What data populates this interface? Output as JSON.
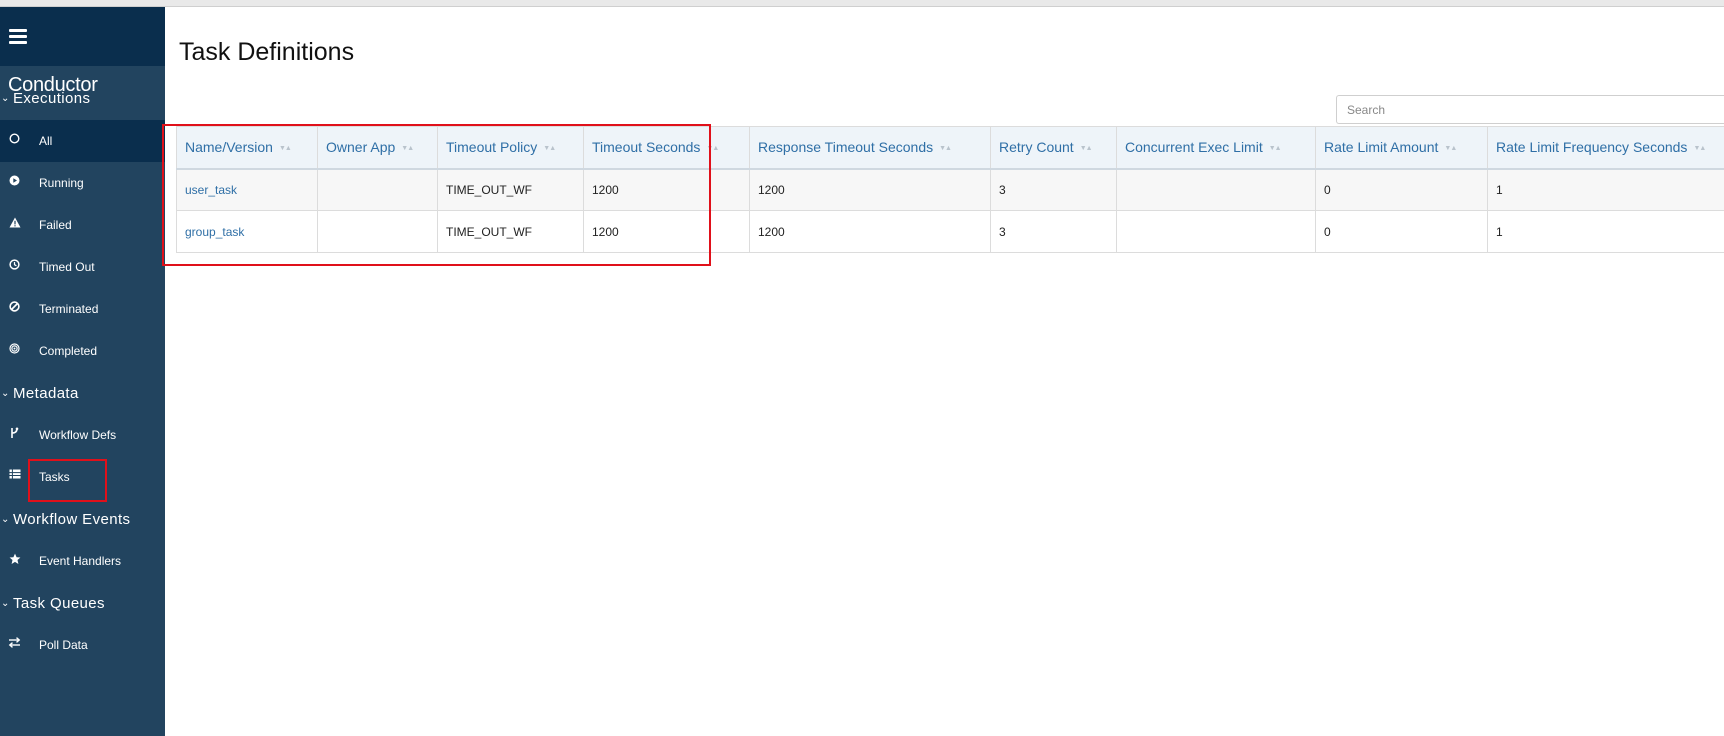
{
  "app": {
    "brand": "Conductor"
  },
  "sidebar": {
    "sections": [
      {
        "label": "Executions",
        "items": [
          {
            "label": "All",
            "icon": "circle-outline-icon",
            "active": true
          },
          {
            "label": "Running",
            "icon": "play-circle-icon"
          },
          {
            "label": "Failed",
            "icon": "warning-icon"
          },
          {
            "label": "Timed Out",
            "icon": "clock-icon"
          },
          {
            "label": "Terminated",
            "icon": "ban-icon"
          },
          {
            "label": "Completed",
            "icon": "target-icon"
          }
        ]
      },
      {
        "label": "Metadata",
        "items": [
          {
            "label": "Workflow Defs",
            "icon": "branch-icon"
          },
          {
            "label": "Tasks",
            "icon": "list-icon"
          }
        ]
      },
      {
        "label": "Workflow Events",
        "items": [
          {
            "label": "Event Handlers",
            "icon": "star-icon"
          }
        ]
      },
      {
        "label": "Task Queues",
        "items": [
          {
            "label": "Poll Data",
            "icon": "exchange-icon"
          }
        ]
      }
    ]
  },
  "main": {
    "title": "Task Definitions",
    "search_placeholder": "Search",
    "table": {
      "columns": [
        "Name/Version",
        "Owner App",
        "Timeout Policy",
        "Timeout Seconds",
        "Response Timeout Seconds",
        "Retry Count",
        "Concurrent Exec Limit",
        "Rate Limit Amount",
        "Rate Limit Frequency Seconds"
      ],
      "rows": [
        [
          "user_task",
          "",
          "TIME_OUT_WF",
          "1200",
          "1200",
          "3",
          "",
          "0",
          "1"
        ],
        [
          "group_task",
          "",
          "TIME_OUT_WF",
          "1200",
          "1200",
          "3",
          "",
          "0",
          "1"
        ]
      ]
    }
  },
  "colors": {
    "sidebar_bg": "#22445f",
    "sidebar_active_bg": "#0a2e4d",
    "link": "#2f6fa6",
    "highlight": "#e0101a"
  }
}
